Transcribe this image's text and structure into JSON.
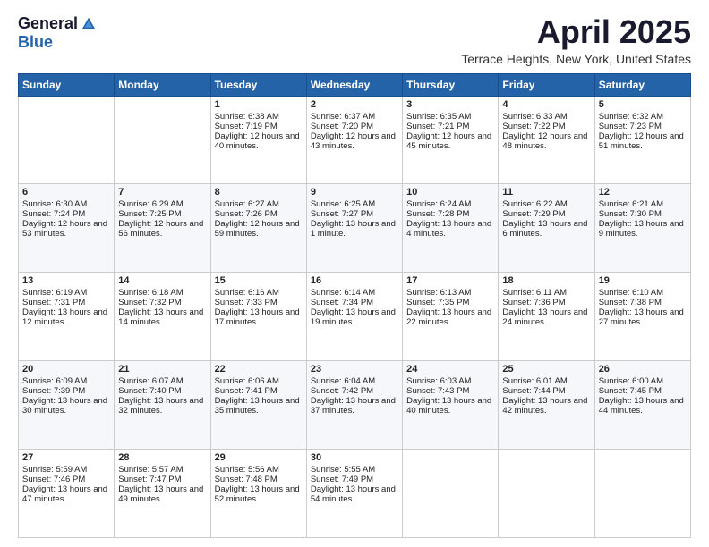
{
  "header": {
    "logo_general": "General",
    "logo_blue": "Blue",
    "month_title": "April 2025",
    "location": "Terrace Heights, New York, United States"
  },
  "days_of_week": [
    "Sunday",
    "Monday",
    "Tuesday",
    "Wednesday",
    "Thursday",
    "Friday",
    "Saturday"
  ],
  "weeks": [
    [
      {
        "day": "",
        "sunrise": "",
        "sunset": "",
        "daylight": ""
      },
      {
        "day": "",
        "sunrise": "",
        "sunset": "",
        "daylight": ""
      },
      {
        "day": "1",
        "sunrise": "Sunrise: 6:38 AM",
        "sunset": "Sunset: 7:19 PM",
        "daylight": "Daylight: 12 hours and 40 minutes."
      },
      {
        "day": "2",
        "sunrise": "Sunrise: 6:37 AM",
        "sunset": "Sunset: 7:20 PM",
        "daylight": "Daylight: 12 hours and 43 minutes."
      },
      {
        "day": "3",
        "sunrise": "Sunrise: 6:35 AM",
        "sunset": "Sunset: 7:21 PM",
        "daylight": "Daylight: 12 hours and 45 minutes."
      },
      {
        "day": "4",
        "sunrise": "Sunrise: 6:33 AM",
        "sunset": "Sunset: 7:22 PM",
        "daylight": "Daylight: 12 hours and 48 minutes."
      },
      {
        "day": "5",
        "sunrise": "Sunrise: 6:32 AM",
        "sunset": "Sunset: 7:23 PM",
        "daylight": "Daylight: 12 hours and 51 minutes."
      }
    ],
    [
      {
        "day": "6",
        "sunrise": "Sunrise: 6:30 AM",
        "sunset": "Sunset: 7:24 PM",
        "daylight": "Daylight: 12 hours and 53 minutes."
      },
      {
        "day": "7",
        "sunrise": "Sunrise: 6:29 AM",
        "sunset": "Sunset: 7:25 PM",
        "daylight": "Daylight: 12 hours and 56 minutes."
      },
      {
        "day": "8",
        "sunrise": "Sunrise: 6:27 AM",
        "sunset": "Sunset: 7:26 PM",
        "daylight": "Daylight: 12 hours and 59 minutes."
      },
      {
        "day": "9",
        "sunrise": "Sunrise: 6:25 AM",
        "sunset": "Sunset: 7:27 PM",
        "daylight": "Daylight: 13 hours and 1 minute."
      },
      {
        "day": "10",
        "sunrise": "Sunrise: 6:24 AM",
        "sunset": "Sunset: 7:28 PM",
        "daylight": "Daylight: 13 hours and 4 minutes."
      },
      {
        "day": "11",
        "sunrise": "Sunrise: 6:22 AM",
        "sunset": "Sunset: 7:29 PM",
        "daylight": "Daylight: 13 hours and 6 minutes."
      },
      {
        "day": "12",
        "sunrise": "Sunrise: 6:21 AM",
        "sunset": "Sunset: 7:30 PM",
        "daylight": "Daylight: 13 hours and 9 minutes."
      }
    ],
    [
      {
        "day": "13",
        "sunrise": "Sunrise: 6:19 AM",
        "sunset": "Sunset: 7:31 PM",
        "daylight": "Daylight: 13 hours and 12 minutes."
      },
      {
        "day": "14",
        "sunrise": "Sunrise: 6:18 AM",
        "sunset": "Sunset: 7:32 PM",
        "daylight": "Daylight: 13 hours and 14 minutes."
      },
      {
        "day": "15",
        "sunrise": "Sunrise: 6:16 AM",
        "sunset": "Sunset: 7:33 PM",
        "daylight": "Daylight: 13 hours and 17 minutes."
      },
      {
        "day": "16",
        "sunrise": "Sunrise: 6:14 AM",
        "sunset": "Sunset: 7:34 PM",
        "daylight": "Daylight: 13 hours and 19 minutes."
      },
      {
        "day": "17",
        "sunrise": "Sunrise: 6:13 AM",
        "sunset": "Sunset: 7:35 PM",
        "daylight": "Daylight: 13 hours and 22 minutes."
      },
      {
        "day": "18",
        "sunrise": "Sunrise: 6:11 AM",
        "sunset": "Sunset: 7:36 PM",
        "daylight": "Daylight: 13 hours and 24 minutes."
      },
      {
        "day": "19",
        "sunrise": "Sunrise: 6:10 AM",
        "sunset": "Sunset: 7:38 PM",
        "daylight": "Daylight: 13 hours and 27 minutes."
      }
    ],
    [
      {
        "day": "20",
        "sunrise": "Sunrise: 6:09 AM",
        "sunset": "Sunset: 7:39 PM",
        "daylight": "Daylight: 13 hours and 30 minutes."
      },
      {
        "day": "21",
        "sunrise": "Sunrise: 6:07 AM",
        "sunset": "Sunset: 7:40 PM",
        "daylight": "Daylight: 13 hours and 32 minutes."
      },
      {
        "day": "22",
        "sunrise": "Sunrise: 6:06 AM",
        "sunset": "Sunset: 7:41 PM",
        "daylight": "Daylight: 13 hours and 35 minutes."
      },
      {
        "day": "23",
        "sunrise": "Sunrise: 6:04 AM",
        "sunset": "Sunset: 7:42 PM",
        "daylight": "Daylight: 13 hours and 37 minutes."
      },
      {
        "day": "24",
        "sunrise": "Sunrise: 6:03 AM",
        "sunset": "Sunset: 7:43 PM",
        "daylight": "Daylight: 13 hours and 40 minutes."
      },
      {
        "day": "25",
        "sunrise": "Sunrise: 6:01 AM",
        "sunset": "Sunset: 7:44 PM",
        "daylight": "Daylight: 13 hours and 42 minutes."
      },
      {
        "day": "26",
        "sunrise": "Sunrise: 6:00 AM",
        "sunset": "Sunset: 7:45 PM",
        "daylight": "Daylight: 13 hours and 44 minutes."
      }
    ],
    [
      {
        "day": "27",
        "sunrise": "Sunrise: 5:59 AM",
        "sunset": "Sunset: 7:46 PM",
        "daylight": "Daylight: 13 hours and 47 minutes."
      },
      {
        "day": "28",
        "sunrise": "Sunrise: 5:57 AM",
        "sunset": "Sunset: 7:47 PM",
        "daylight": "Daylight: 13 hours and 49 minutes."
      },
      {
        "day": "29",
        "sunrise": "Sunrise: 5:56 AM",
        "sunset": "Sunset: 7:48 PM",
        "daylight": "Daylight: 13 hours and 52 minutes."
      },
      {
        "day": "30",
        "sunrise": "Sunrise: 5:55 AM",
        "sunset": "Sunset: 7:49 PM",
        "daylight": "Daylight: 13 hours and 54 minutes."
      },
      {
        "day": "",
        "sunrise": "",
        "sunset": "",
        "daylight": ""
      },
      {
        "day": "",
        "sunrise": "",
        "sunset": "",
        "daylight": ""
      },
      {
        "day": "",
        "sunrise": "",
        "sunset": "",
        "daylight": ""
      }
    ]
  ]
}
